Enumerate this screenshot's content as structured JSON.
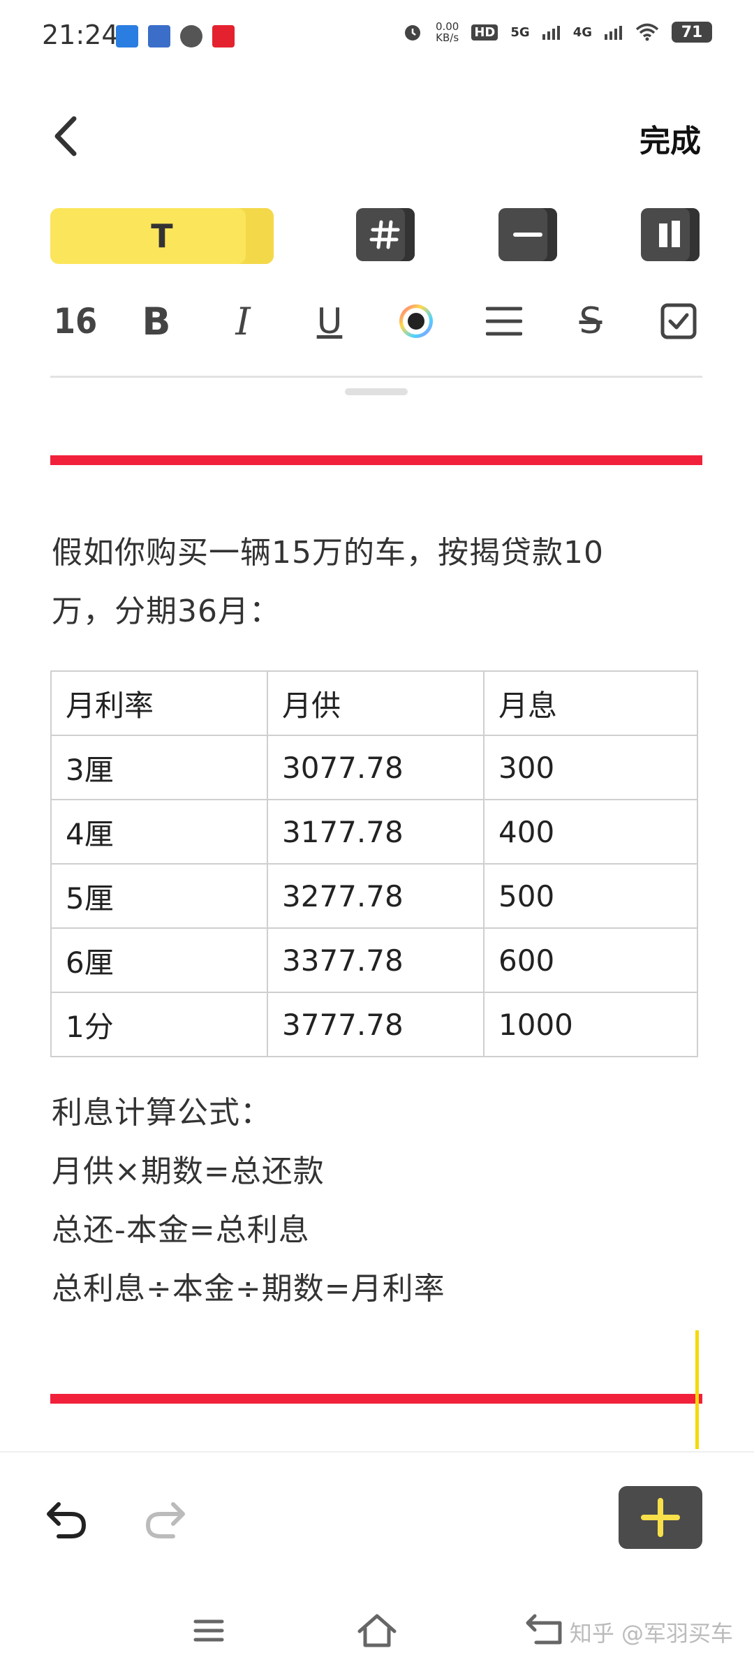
{
  "status_bar": {
    "time": "21:24",
    "speed_value": "0.00",
    "speed_unit": "KB/s",
    "hd": "HD",
    "net1": "5G",
    "net2": "4G",
    "battery": "71"
  },
  "header": {
    "done_label": "完成"
  },
  "tabs": {
    "text_label": "T"
  },
  "toolbar": {
    "font_size": "16",
    "bold": "B",
    "italic": "I",
    "underline": "U",
    "strike": "S"
  },
  "content": {
    "intro_line1": "假如你购买一辆15万的车，按揭贷款10",
    "intro_line2": "万，分期36月：",
    "table": {
      "headers": [
        "月利率",
        "月供",
        "月息"
      ],
      "rows": [
        [
          "3厘",
          "3077.78",
          "300"
        ],
        [
          "4厘",
          "3177.78",
          "400"
        ],
        [
          "5厘",
          "3277.78",
          "500"
        ],
        [
          "6厘",
          "3377.78",
          "600"
        ],
        [
          "1分",
          "3777.78",
          "1000"
        ]
      ]
    },
    "formula_title": "利息计算公式：",
    "formula1": "月供×期数=总还款",
    "formula2": "总还-本金=总利息",
    "formula3": "总利息÷本金÷期数=月利率"
  },
  "watermark": "知乎 @军羽买车",
  "colors": {
    "accent_yellow": "#fbe55b",
    "red_line": "#f2213b",
    "dark_button": "#4b4b4b"
  }
}
